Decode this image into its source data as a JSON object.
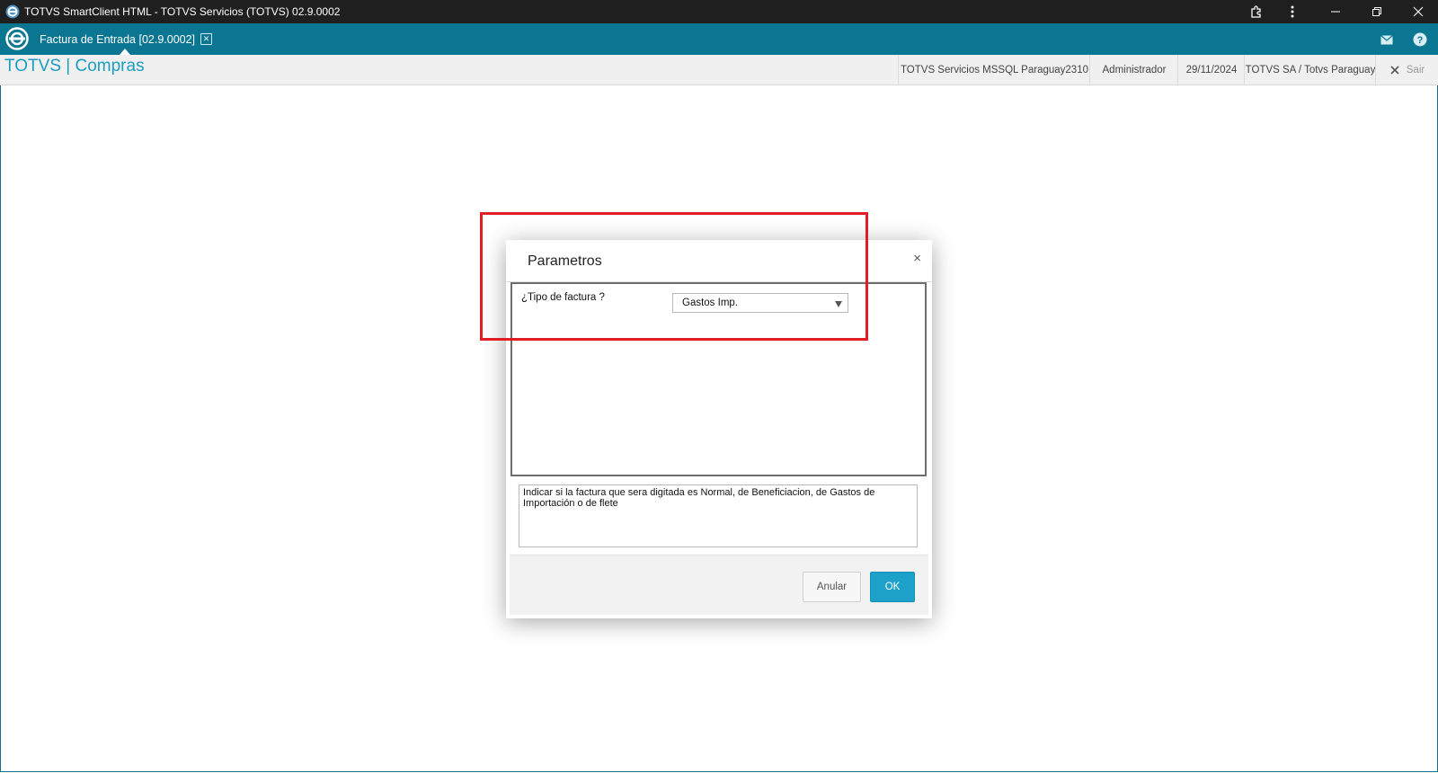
{
  "window": {
    "title": "TOTVS SmartClient HTML - TOTVS Servicios (TOTVS) 02.9.0002",
    "icons": [
      "extension-icon",
      "more-vertical-icon",
      "minimize-icon",
      "restore-icon",
      "close-icon"
    ]
  },
  "tabs": [
    {
      "label": "Factura de Entrada [02.9.0002]",
      "close_glyph": "✕"
    }
  ],
  "tabbar": {
    "icons": [
      "mail-icon",
      "help-icon"
    ]
  },
  "header": {
    "brand": "TOTVS | Compras",
    "server": "TOTVS Servicios MSSQL Paraguay2310",
    "user": "Administrador",
    "date": "29/11/2024",
    "company": "TOTVS SA / Totvs Paraguay",
    "logout_label": "Sair"
  },
  "dialog": {
    "title": "Parametros",
    "close_glyph": "×",
    "param": {
      "label": "¿Tipo de factura ?",
      "value": "Gastos Imp."
    },
    "help_text": "Indicar si la factura que sera digitada es Normal, de Beneficiacion, de Gastos de Importación o de flete",
    "buttons": {
      "cancel": "Anular",
      "ok": "OK"
    }
  },
  "colors": {
    "titlebar": "#1f1f1f",
    "tabbar": "#0b7691",
    "brand": "#1a9dc4",
    "ok_button": "#1da1c9",
    "annotation_box": "#e01e26"
  }
}
